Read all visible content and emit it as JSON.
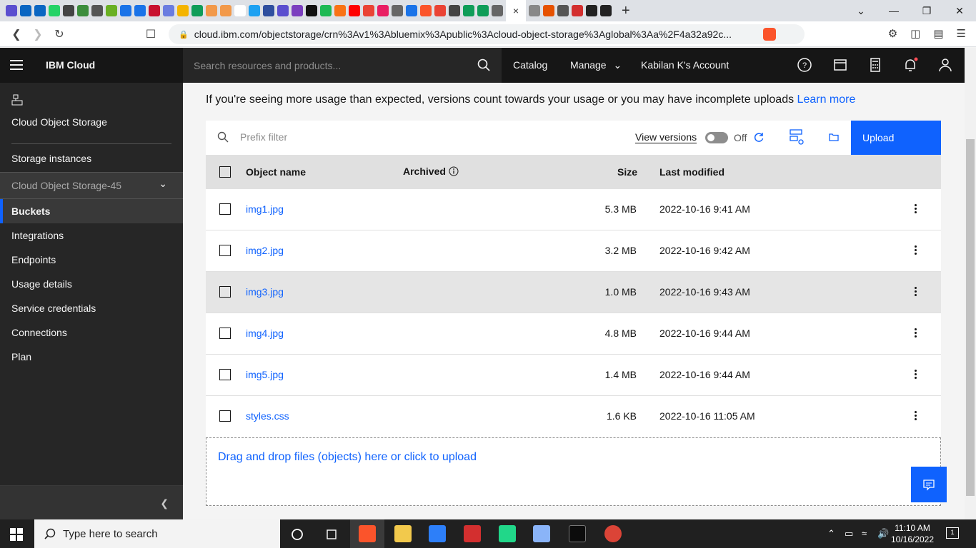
{
  "browser": {
    "active_tab_close": "×",
    "new_tab": "+",
    "url": "cloud.ibm.com/objectstorage/crn%3Av1%3Abluemix%3Apublic%3Acloud-object-storage%3Aglobal%3Aa%2F4a32a92c...",
    "brave_count": "3",
    "favicons": [
      "#5b4fcf",
      "#0a66c2",
      "#0a66c2",
      "#25d366",
      "#444",
      "#3c8d3c",
      "#555",
      "#6ab023",
      "#1a73e8",
      "#1a73e8",
      "#c8102e",
      "#6a7ce0",
      "#f4b400",
      "#0f9d58",
      "#f2994a",
      "#f2994a",
      "#fff",
      "#1da1f2",
      "#2f4f9f",
      "#5b4fcf",
      "#7b3fbf",
      "#111",
      "#1db954",
      "#f97316",
      "#ff0000",
      "#ea4335",
      "#e91e63",
      "#666",
      "#1a73e8",
      "#fb542b",
      "#ea4335",
      "#444",
      "#0f9d58",
      "#0f9d58",
      "#666",
      "#888",
      "#e65100",
      "#555",
      "#d32f2f",
      "#222",
      "#222"
    ]
  },
  "header": {
    "brand": "IBM Cloud",
    "search_placeholder": "Search resources and products...",
    "catalog": "Catalog",
    "manage": "Manage",
    "account": "Kabilan K's Account"
  },
  "sidebar": {
    "service_title": "Cloud Object Storage",
    "storage_instances": "Storage instances",
    "instance_name": "Cloud Object Storage-45",
    "items": [
      "Buckets",
      "Integrations",
      "Endpoints",
      "Usage details",
      "Service credentials",
      "Connections",
      "Plan"
    ]
  },
  "main": {
    "notice_text": "If you're seeing more usage than expected, versions count towards your usage or you may have incomplete uploads",
    "learn_more": "Learn more",
    "prefix_placeholder": "Prefix filter",
    "view_versions": "View versions",
    "toggle_state": "Off",
    "upload_label": "Upload",
    "columns": {
      "name": "Object name",
      "archived": "Archived",
      "size": "Size",
      "modified": "Last modified"
    },
    "rows": [
      {
        "name": "img1.jpg",
        "size": "5.3 MB",
        "modified": "2022-10-16 9:41 AM"
      },
      {
        "name": "img2.jpg",
        "size": "3.2 MB",
        "modified": "2022-10-16 9:42 AM"
      },
      {
        "name": "img3.jpg",
        "size": "1.0 MB",
        "modified": "2022-10-16 9:43 AM"
      },
      {
        "name": "img4.jpg",
        "size": "4.8 MB",
        "modified": "2022-10-16 9:44 AM"
      },
      {
        "name": "img5.jpg",
        "size": "1.4 MB",
        "modified": "2022-10-16 9:44 AM"
      },
      {
        "name": "styles.css",
        "size": "1.6 KB",
        "modified": "2022-10-16 11:05 AM"
      }
    ],
    "dropzone_text": "Drag and drop files (objects) here or click to upload"
  },
  "taskbar": {
    "search_placeholder": "Type here to search",
    "time": "11:10 AM",
    "date": "10/16/2022",
    "notification_count": "1"
  },
  "colors": {
    "accent": "#0f62fe",
    "header_bg": "#161616",
    "sidebar_bg": "#262626"
  }
}
